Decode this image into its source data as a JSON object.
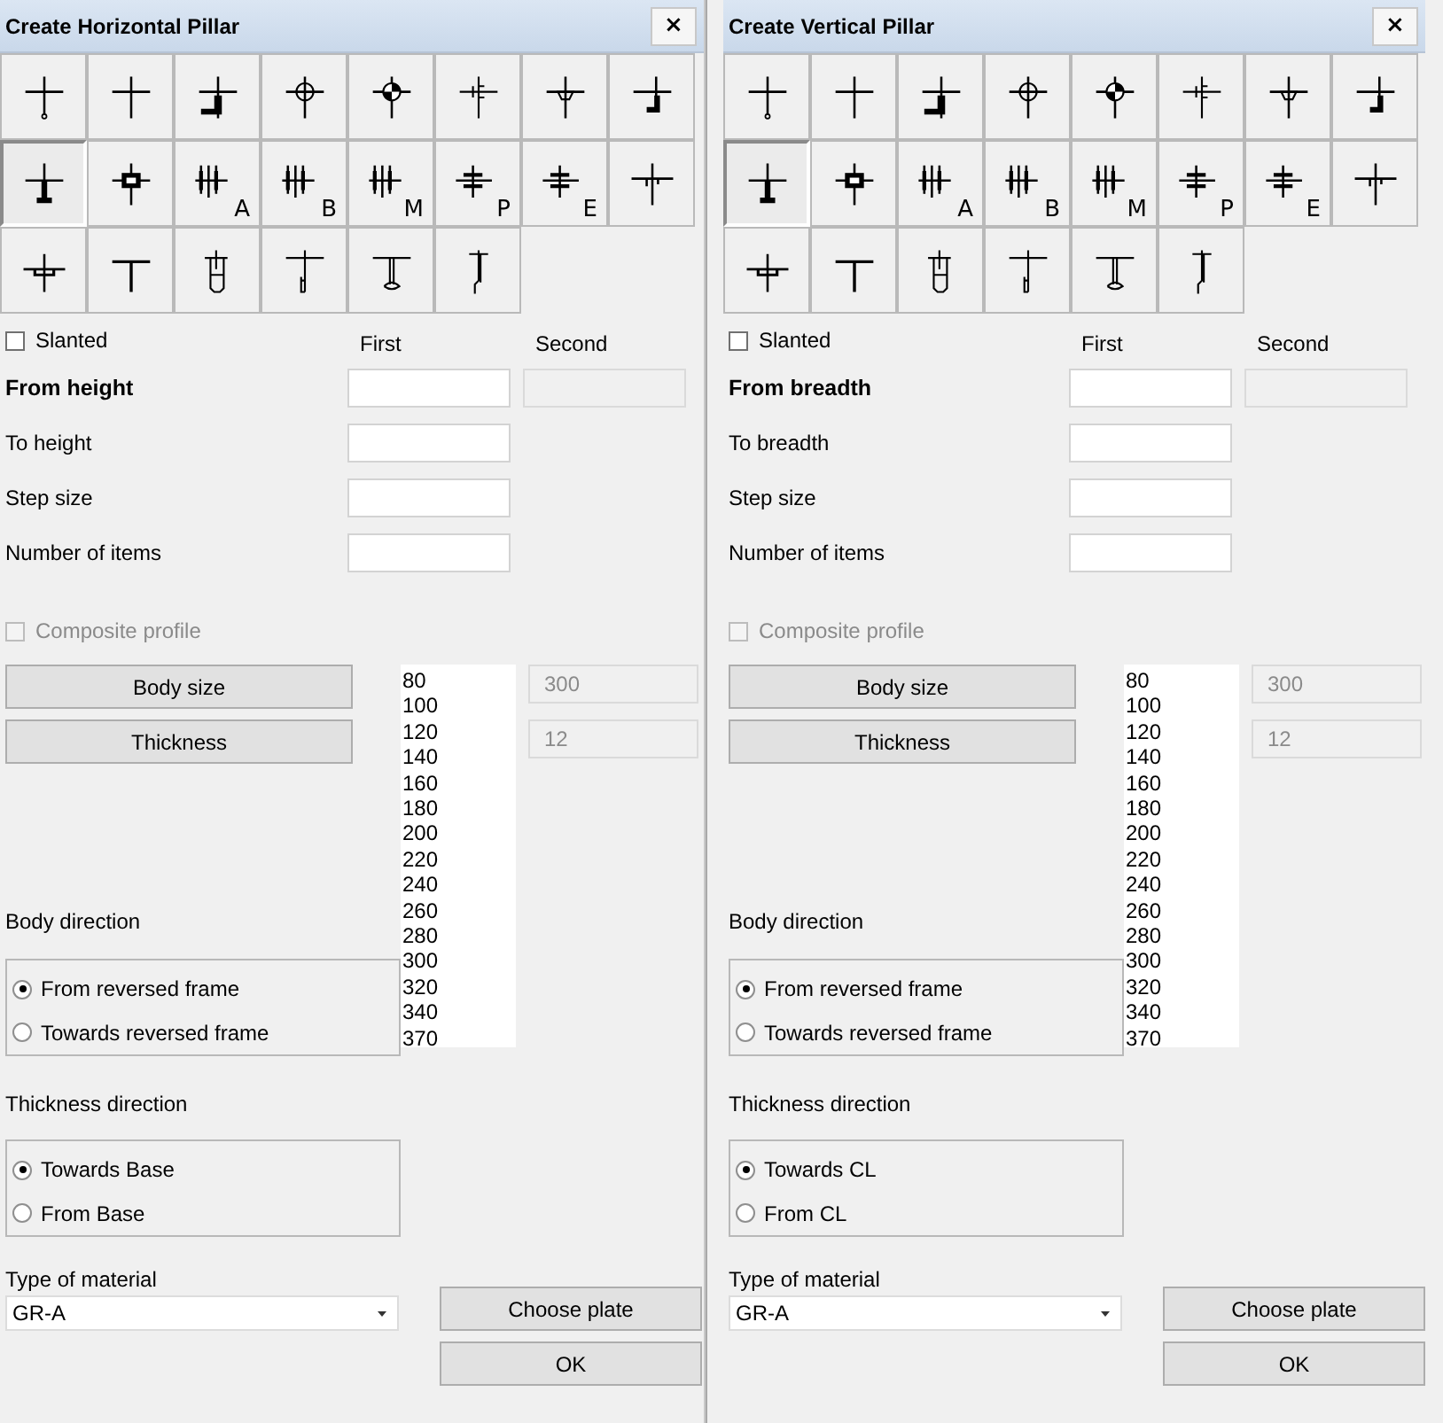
{
  "dialogs": [
    {
      "title": "Create Horizontal Pillar",
      "close": "×",
      "profiles": [
        {
          "kind": "bulb",
          "selected": false
        },
        {
          "kind": "cross",
          "selected": false
        },
        {
          "kind": "angle",
          "selected": false
        },
        {
          "kind": "ring",
          "selected": false
        },
        {
          "kind": "halfdisc",
          "selected": false
        },
        {
          "kind": "channel",
          "selected": false
        },
        {
          "kind": "halfround",
          "selected": false
        },
        {
          "kind": "smallangle",
          "selected": false
        },
        {
          "kind": "tee",
          "selected": true
        },
        {
          "kind": "box",
          "selected": false
        },
        {
          "kind": "triple",
          "letter": "A",
          "selected": false
        },
        {
          "kind": "triple",
          "letter": "B",
          "selected": false
        },
        {
          "kind": "triple",
          "letter": "M",
          "selected": false
        },
        {
          "kind": "double",
          "letter": "P",
          "selected": false
        },
        {
          "kind": "double",
          "letter": "E",
          "selected": false
        },
        {
          "kind": "comb",
          "selected": false
        },
        {
          "kind": "cup",
          "selected": false
        },
        {
          "kind": "topbar",
          "selected": false
        },
        {
          "kind": "tube",
          "selected": false
        },
        {
          "kind": "stemfoot",
          "selected": false
        },
        {
          "kind": "flange",
          "selected": false
        },
        {
          "kind": "hook",
          "selected": false
        }
      ],
      "slanted": {
        "label": "Slanted",
        "checked": false
      },
      "columns": [
        "First",
        "Second"
      ],
      "fields": [
        {
          "label": "From height",
          "emphasized": true,
          "second": {
            "disabled": true
          }
        },
        {
          "label": "To height",
          "emphasized": false
        },
        {
          "label": "Step size",
          "emphasized": false
        },
        {
          "label": "Number of items",
          "emphasized": false
        }
      ],
      "composite": {
        "label": "Composite profile",
        "checked": false,
        "disabled": true
      },
      "size_buttons": [
        "Body size",
        "Thickness"
      ],
      "size_values": [
        {
          "value": "300",
          "disabled": true
        },
        {
          "value": "12",
          "disabled": true
        }
      ],
      "size_list": [
        "80",
        "100",
        "120",
        "140",
        "160",
        "180",
        "200",
        "220",
        "240",
        "260",
        "280",
        "300",
        "320",
        "340",
        "370"
      ],
      "body_direction": {
        "label": "Body direction",
        "options": [
          {
            "label": "From reversed frame",
            "selected": true
          },
          {
            "label": "Towards reversed frame",
            "selected": false
          }
        ]
      },
      "thickness_direction": {
        "label": "Thickness direction",
        "options": [
          {
            "label": "Towards Base",
            "selected": true
          },
          {
            "label": "From Base",
            "selected": false
          }
        ]
      },
      "material": {
        "label": "Type of material",
        "value": "GR-A"
      },
      "choose_plate": "Choose plate",
      "ok": "OK"
    },
    {
      "title": "Create Vertical Pillar",
      "close": "×",
      "profiles": [
        {
          "kind": "bulb",
          "selected": false
        },
        {
          "kind": "cross",
          "selected": false
        },
        {
          "kind": "angle",
          "selected": false
        },
        {
          "kind": "ring",
          "selected": false
        },
        {
          "kind": "halfdisc",
          "selected": false
        },
        {
          "kind": "channel",
          "selected": false
        },
        {
          "kind": "halfround",
          "selected": false
        },
        {
          "kind": "smallangle",
          "selected": false
        },
        {
          "kind": "tee",
          "selected": true
        },
        {
          "kind": "box",
          "selected": false
        },
        {
          "kind": "triple",
          "letter": "A",
          "selected": false
        },
        {
          "kind": "triple",
          "letter": "B",
          "selected": false
        },
        {
          "kind": "triple",
          "letter": "M",
          "selected": false
        },
        {
          "kind": "double",
          "letter": "P",
          "selected": false
        },
        {
          "kind": "double",
          "letter": "E",
          "selected": false
        },
        {
          "kind": "comb",
          "selected": false
        },
        {
          "kind": "cup",
          "selected": false
        },
        {
          "kind": "topbar",
          "selected": false
        },
        {
          "kind": "tube",
          "selected": false
        },
        {
          "kind": "stemfoot",
          "selected": false
        },
        {
          "kind": "flange",
          "selected": false
        },
        {
          "kind": "hook",
          "selected": false
        }
      ],
      "slanted": {
        "label": "Slanted",
        "checked": false
      },
      "columns": [
        "First",
        "Second"
      ],
      "fields": [
        {
          "label": "From breadth",
          "emphasized": true,
          "second": {
            "disabled": true
          }
        },
        {
          "label": "To breadth",
          "emphasized": false
        },
        {
          "label": "Step size",
          "emphasized": false
        },
        {
          "label": "Number of items",
          "emphasized": false
        }
      ],
      "composite": {
        "label": "Composite profile",
        "checked": false,
        "disabled": true
      },
      "size_buttons": [
        "Body size",
        "Thickness"
      ],
      "size_values": [
        {
          "value": "300",
          "disabled": true
        },
        {
          "value": "12",
          "disabled": true
        }
      ],
      "size_list": [
        "80",
        "100",
        "120",
        "140",
        "160",
        "180",
        "200",
        "220",
        "240",
        "260",
        "280",
        "300",
        "320",
        "340",
        "370"
      ],
      "body_direction": {
        "label": "Body direction",
        "options": [
          {
            "label": "From reversed frame",
            "selected": true
          },
          {
            "label": "Towards reversed frame",
            "selected": false
          }
        ]
      },
      "thickness_direction": {
        "label": "Thickness direction",
        "options": [
          {
            "label": "Towards CL",
            "selected": true
          },
          {
            "label": "From CL",
            "selected": false
          }
        ]
      },
      "material": {
        "label": "Type of material",
        "value": "GR-A"
      },
      "choose_plate": "Choose plate",
      "ok": "OK"
    }
  ]
}
